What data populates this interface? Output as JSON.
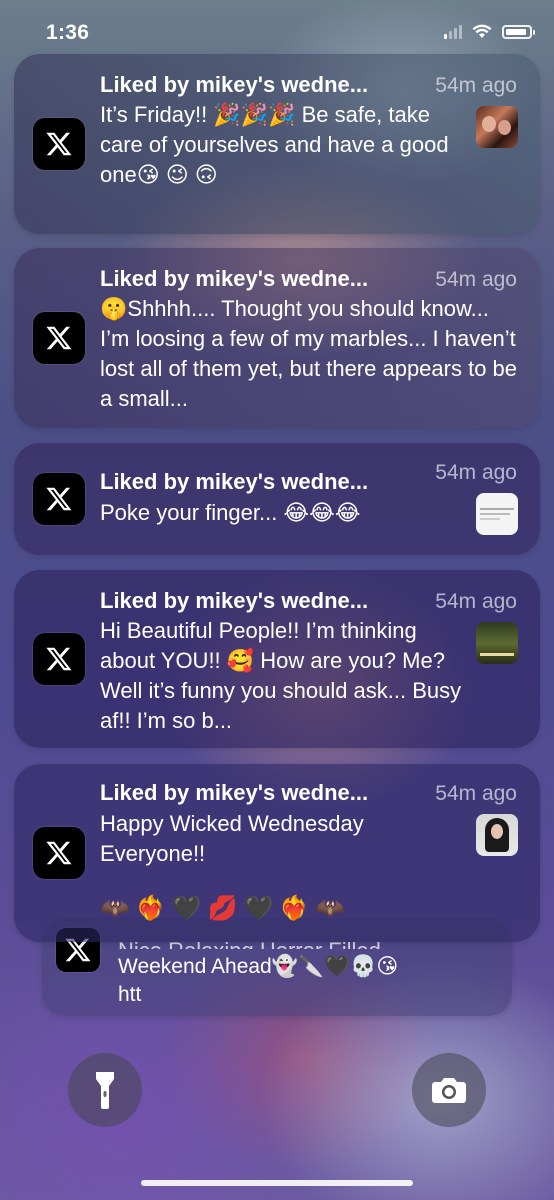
{
  "status_bar": {
    "time": "1:36",
    "battery_level": 0.9,
    "signal_bars_active": 1
  },
  "notifications": [
    {
      "app_icon": "x-logo-icon",
      "title": "Liked by mikey's wedne...",
      "time": "54m ago",
      "body": "It’s Friday!! 🎉🎉🎉 Be safe, take care of yourselves and have a good one😘 😉 🙃",
      "thumbnail": "photo-two-women"
    },
    {
      "app_icon": "x-logo-icon",
      "title": "Liked by mikey's wedne...",
      "time": "54m ago",
      "body": "🤫Shhhh.... Thought you should know... I’m loosing a few of my marbles... I haven’t lost all of them yet, but there appears to be a small..."
    },
    {
      "app_icon": "x-logo-icon",
      "title": "Liked by mikey's wedne...",
      "time": "54m ago",
      "body": "Poke your finger... 😂😂😂",
      "thumbnail": "text-image"
    },
    {
      "app_icon": "x-logo-icon",
      "title": "Liked by mikey's wedne...",
      "time": "54m ago",
      "body": "Hi Beautiful People!! I’m thinking about YOU!! 🥰 How are you? Me? Well it’s funny you should ask... Busy af!! I’m so b...",
      "thumbnail": "photo-text-image"
    },
    {
      "app_icon": "x-logo-icon",
      "title": "Liked by mikey's wedne...",
      "time": "54m ago",
      "body": "Happy Wicked Wednesday Everyone!!",
      "emoji_line": "🦇❤️‍🔥🖤💋🖤❤️‍🔥🦇",
      "thumbnail": "photo-woman"
    }
  ],
  "stacked_notification": {
    "app_icon": "x-logo-icon",
    "body_partial": "Nice Relaxing Horror Filled",
    "body": "Weekend Ahead👻🔪🖤💀😘",
    "body_tail": "htt"
  },
  "quick_actions": {
    "left": "flashlight-icon",
    "right": "camera-icon"
  }
}
